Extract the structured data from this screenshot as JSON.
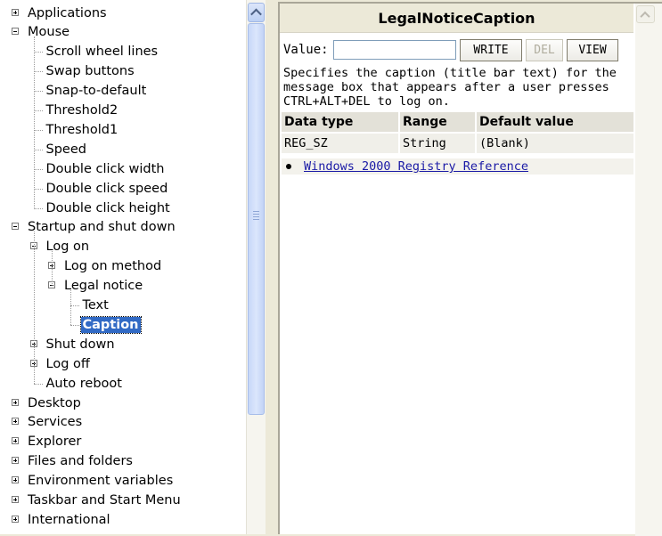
{
  "tree": {
    "items": [
      {
        "label": "Applications",
        "depth": 0,
        "state": "plus"
      },
      {
        "label": "Mouse",
        "depth": 0,
        "state": "minus"
      },
      {
        "label": "Scroll wheel lines",
        "depth": 1,
        "state": "leaf"
      },
      {
        "label": "Swap buttons",
        "depth": 1,
        "state": "leaf"
      },
      {
        "label": "Snap-to-default",
        "depth": 1,
        "state": "leaf"
      },
      {
        "label": "Threshold2",
        "depth": 1,
        "state": "leaf"
      },
      {
        "label": "Threshold1",
        "depth": 1,
        "state": "leaf"
      },
      {
        "label": "Speed",
        "depth": 1,
        "state": "leaf"
      },
      {
        "label": "Double click width",
        "depth": 1,
        "state": "leaf"
      },
      {
        "label": "Double click speed",
        "depth": 1,
        "state": "leaf"
      },
      {
        "label": "Double click height",
        "depth": 1,
        "state": "leaf"
      },
      {
        "label": "Startup and shut down",
        "depth": 0,
        "state": "minus"
      },
      {
        "label": "Log on",
        "depth": 1,
        "state": "minus"
      },
      {
        "label": "Log on method",
        "depth": 2,
        "state": "plus"
      },
      {
        "label": "Legal notice",
        "depth": 2,
        "state": "minus"
      },
      {
        "label": "Text",
        "depth": 3,
        "state": "leaf"
      },
      {
        "label": "Caption",
        "depth": 3,
        "state": "leaf",
        "selected": true
      },
      {
        "label": "Shut down",
        "depth": 1,
        "state": "plus"
      },
      {
        "label": "Log off",
        "depth": 1,
        "state": "plus"
      },
      {
        "label": "Auto reboot",
        "depth": 1,
        "state": "leaf"
      },
      {
        "label": "Desktop",
        "depth": 0,
        "state": "plus"
      },
      {
        "label": "Services",
        "depth": 0,
        "state": "plus"
      },
      {
        "label": "Explorer",
        "depth": 0,
        "state": "plus"
      },
      {
        "label": "Files and folders",
        "depth": 0,
        "state": "plus"
      },
      {
        "label": "Environment variables",
        "depth": 0,
        "state": "plus"
      },
      {
        "label": "Taskbar and Start Menu",
        "depth": 0,
        "state": "plus"
      },
      {
        "label": "International",
        "depth": 0,
        "state": "plus"
      }
    ]
  },
  "content": {
    "title": "LegalNoticeCaption",
    "value_label": "Value:",
    "value_input": "",
    "write_label": "WRITE",
    "del_label": "DEL",
    "view_label": "VIEW",
    "description": "Specifies the caption (title bar text) for the\nmessage box that appears after a user presses\nCTRL+ALT+DEL to log on.",
    "table": {
      "headers": [
        "Data type",
        "Range",
        "Default value"
      ],
      "row": [
        "REG_SZ",
        "String",
        "(Blank)"
      ]
    },
    "reference_link": "Windows 2000 Registry Reference"
  },
  "colors": {
    "selection": "#316ac5",
    "link": "#1a1aa6"
  }
}
